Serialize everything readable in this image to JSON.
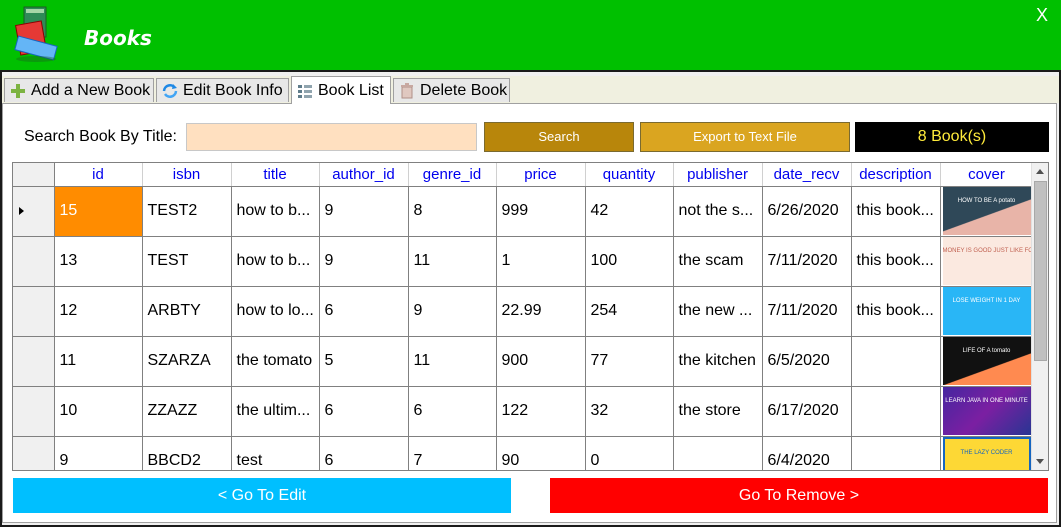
{
  "window": {
    "title": "Books",
    "close_label": "X"
  },
  "tabs": [
    {
      "label": "Add a New Book"
    },
    {
      "label": "Edit Book Info"
    },
    {
      "label": "Book List"
    },
    {
      "label": "Delete Book"
    }
  ],
  "search": {
    "label": "Search Book By Title:",
    "value": "",
    "placeholder": "",
    "search_button": "Search",
    "export_button": "Export to Text File",
    "count": "8 Book(s)"
  },
  "grid": {
    "columns": [
      "id",
      "isbn",
      "title",
      "author_id",
      "genre_id",
      "price",
      "quantity",
      "publisher",
      "date_recv",
      "description",
      "cover"
    ],
    "rows": [
      {
        "id": "15",
        "isbn": "TEST2",
        "title": "how to b...",
        "author_id": "9",
        "genre_id": "8",
        "price": "999",
        "quantity": "42",
        "publisher": "not the s...",
        "date_recv": "6/26/2020",
        "description": "this book...",
        "cover_text": "HOW TO BE A potato"
      },
      {
        "id": "13",
        "isbn": "TEST",
        "title": "how to b...",
        "author_id": "9",
        "genre_id": "11",
        "price": "1",
        "quantity": "100",
        "publisher": "the scam",
        "date_recv": "7/11/2020",
        "description": "this book...",
        "cover_text": "MONEY IS GOOD JUST LIKE FOOD"
      },
      {
        "id": "12",
        "isbn": "ARBTY",
        "title": "how to lo...",
        "author_id": "6",
        "genre_id": "9",
        "price": "22.99",
        "quantity": "254",
        "publisher": "the new ...",
        "date_recv": "7/11/2020",
        "description": "this book...",
        "cover_text": "LOSE WEIGHT IN 1 DAY"
      },
      {
        "id": "11",
        "isbn": "SZARZA",
        "title": "the tomato",
        "author_id": "5",
        "genre_id": "11",
        "price": "900",
        "quantity": "77",
        "publisher": "the kitchen",
        "date_recv": "6/5/2020",
        "description": "",
        "cover_text": "LIFE OF A tomato"
      },
      {
        "id": "10",
        "isbn": "ZZAZZ",
        "title": "the ultim...",
        "author_id": "6",
        "genre_id": "6",
        "price": "122",
        "quantity": "32",
        "publisher": "the store",
        "date_recv": "6/17/2020",
        "description": "",
        "cover_text": "LEARN JAVA IN ONE MINUTE"
      },
      {
        "id": "9",
        "isbn": "BBCD2",
        "title": "test",
        "author_id": "6",
        "genre_id": "7",
        "price": "90",
        "quantity": "0",
        "publisher": "",
        "date_recv": "6/4/2020",
        "description": "",
        "cover_text": "THE LAZY CODER"
      }
    ]
  },
  "nav": {
    "edit_button": "< Go To Edit",
    "remove_button": "Go To Remove >"
  },
  "colors": {
    "titlebar": "#00c000",
    "search_bg": "#ffe0c0",
    "selected_cell": "#ff8c00",
    "edit": "#00bfff",
    "remove": "#ff0000"
  }
}
